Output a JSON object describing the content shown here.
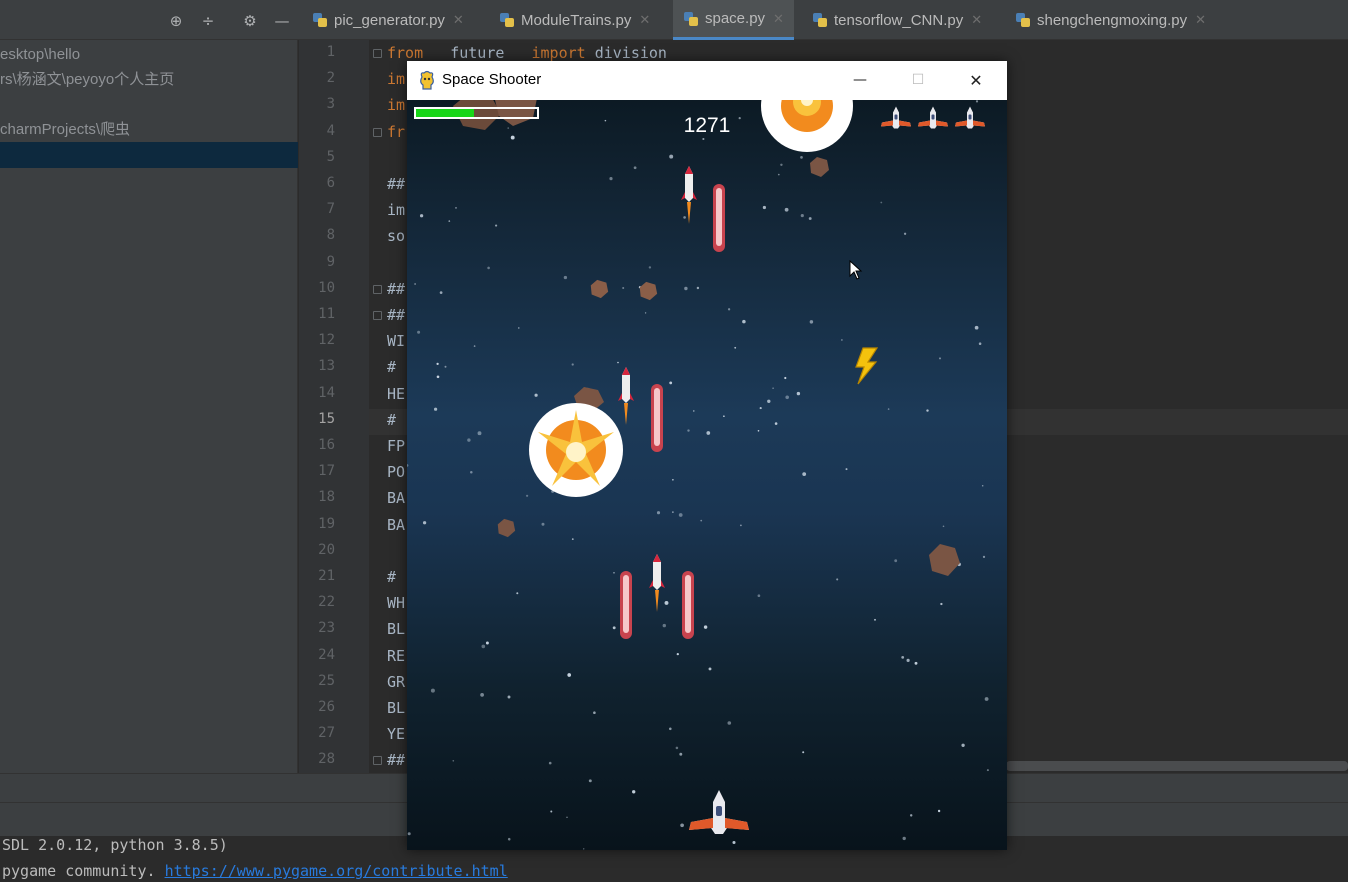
{
  "ide": {
    "tabs": [
      {
        "label": "pic_generator.py",
        "active": false
      },
      {
        "label": "ModuleTrains.py",
        "active": false
      },
      {
        "label": "space.py",
        "active": true
      },
      {
        "label": "tensorflow_CNN.py",
        "active": false
      },
      {
        "label": "shengchengmoxing.py",
        "active": false
      }
    ],
    "project_tree": [
      "esktop\\hello",
      "rs\\杨涵文\\peyoyo个人主页",
      "",
      "charmProjects\\爬虫",
      ""
    ],
    "line_numbers": [
      "1",
      "2",
      "3",
      "4",
      "5",
      "6",
      "7",
      "8",
      "9",
      "10",
      "11",
      "12",
      "13",
      "14",
      "15",
      "16",
      "17",
      "18",
      "19",
      "20",
      "21",
      "22",
      "23",
      "24",
      "25",
      "26",
      "27",
      "28"
    ],
    "current_line": "15",
    "code_first_line": {
      "kw1": "from",
      "mod": " __future__ ",
      "kw2": "import",
      "rest": " division"
    },
    "code_fragments": [
      "im",
      "im",
      "fr",
      "",
      "##",
      "im",
      "so",
      "",
      "##",
      "##",
      "WI",
      "#",
      "HE",
      "#",
      "FP",
      "PO",
      "BA",
      "BA",
      "",
      "#",
      "WH",
      "BL",
      "RE",
      "GR",
      "BL",
      "YE",
      "##"
    ],
    "console": {
      "line1": "SDL 2.0.12, python 3.8.5)",
      "line2_prefix": "pygame community. ",
      "line2_link": "https://www.pygame.org/contribute.html"
    }
  },
  "game": {
    "window_title": "Space Shooter",
    "minimize_glyph": "—",
    "maximize_glyph": "☐",
    "close_glyph": "✕",
    "score": "1271",
    "health_fraction": 0.48,
    "lives": 3,
    "colors": {
      "health": "#18d618",
      "bullet": "#d9525a",
      "explosion": "#f28b1e"
    }
  }
}
